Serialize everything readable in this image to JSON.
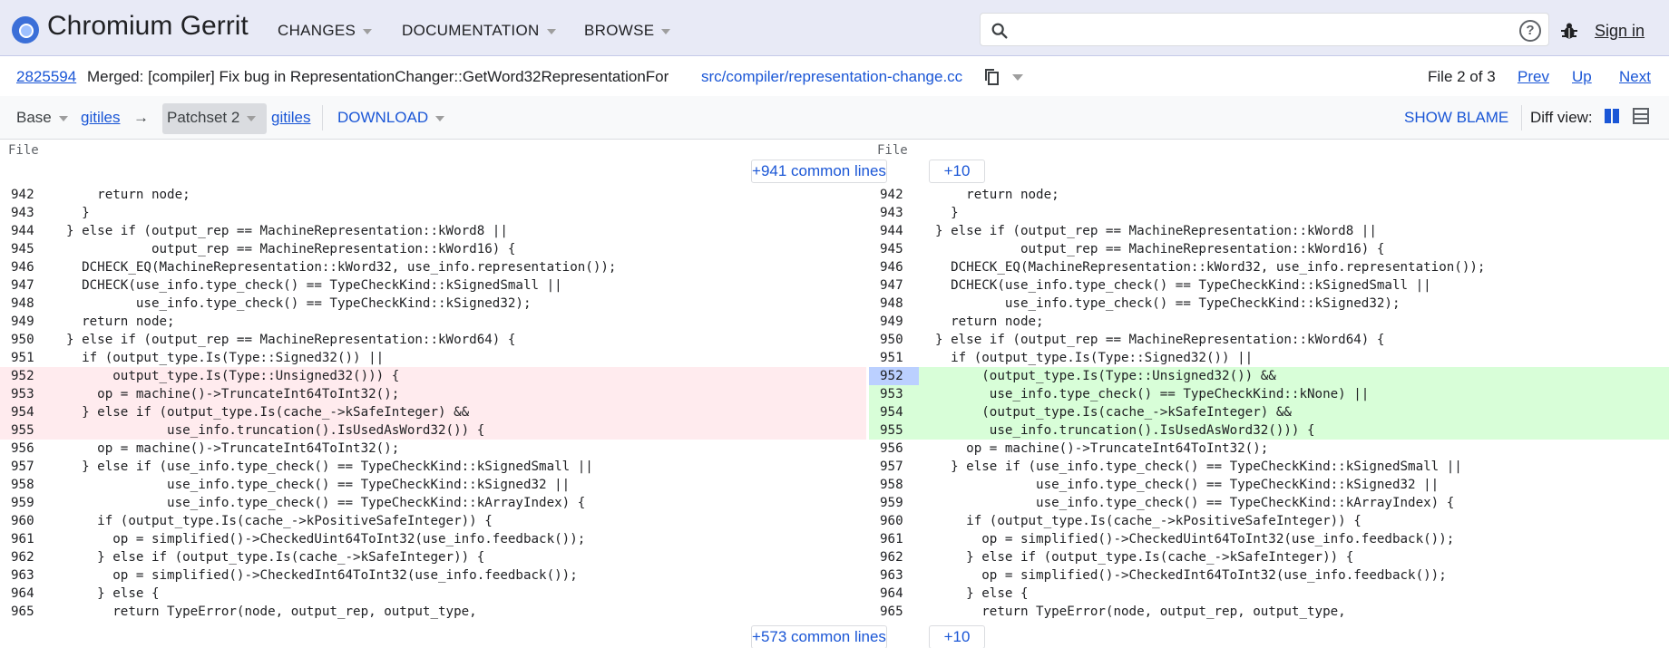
{
  "header": {
    "brand": "Chromium Gerrit",
    "nav": [
      "CHANGES",
      "DOCUMENTATION",
      "BROWSE"
    ],
    "search_placeholder": "",
    "sign_in": "Sign in"
  },
  "change": {
    "number": "2825594",
    "subject": "Merged: [compiler] Fix bug in RepresentationChanger::GetWord32RepresentationFor",
    "file_path": "src/compiler/representation-change.cc",
    "file_of": "File 2 of 3",
    "prev": "Prev",
    "up": "Up",
    "next": "Next"
  },
  "toolbar": {
    "base": "Base",
    "gitiles_left": "gitiles",
    "arrow": "→",
    "patchset": "Patchset 2",
    "gitiles_right": "gitiles",
    "download": "DOWNLOAD",
    "show_blame": "SHOW BLAME",
    "diff_view": "Diff view:"
  },
  "diff": {
    "file_label": "File",
    "top_common": "+941 common lines",
    "bottom_common": "+573 common lines",
    "plus_ten": "+10",
    "left_lines": [
      {
        "n": "942",
        "t": "    return node;"
      },
      {
        "n": "943",
        "t": "  }"
      },
      {
        "n": "944",
        "t": "} else if (output_rep == MachineRepresentation::kWord8 ||"
      },
      {
        "n": "945",
        "t": "           output_rep == MachineRepresentation::kWord16) {"
      },
      {
        "n": "946",
        "t": "  DCHECK_EQ(MachineRepresentation::kWord32, use_info.representation());"
      },
      {
        "n": "947",
        "t": "  DCHECK(use_info.type_check() == TypeCheckKind::kSignedSmall ||"
      },
      {
        "n": "948",
        "t": "         use_info.type_check() == TypeCheckKind::kSigned32);"
      },
      {
        "n": "949",
        "t": "  return node;"
      },
      {
        "n": "950",
        "t": "} else if (output_rep == MachineRepresentation::kWord64) {"
      },
      {
        "n": "951",
        "t": "  if (output_type.Is(Type::Signed32()) ||"
      },
      {
        "n": "952",
        "t": "      output_type.Is(Type::Unsigned32())) {"
      },
      {
        "n": "953",
        "t": "    op = machine()->TruncateInt64ToInt32();"
      },
      {
        "n": "954",
        "t": "  } else if (output_type.Is(cache_->kSafeInteger) &&"
      },
      {
        "n": "955",
        "t": "             use_info.truncation().IsUsedAsWord32()) {"
      },
      {
        "n": "956",
        "t": "    op = machine()->TruncateInt64ToInt32();"
      },
      {
        "n": "957",
        "t": "  } else if (use_info.type_check() == TypeCheckKind::kSignedSmall ||"
      },
      {
        "n": "958",
        "t": "             use_info.type_check() == TypeCheckKind::kSigned32 ||"
      },
      {
        "n": "959",
        "t": "             use_info.type_check() == TypeCheckKind::kArrayIndex) {"
      },
      {
        "n": "960",
        "t": "    if (output_type.Is(cache_->kPositiveSafeInteger)) {"
      },
      {
        "n": "961",
        "t": "      op = simplified()->CheckedUint64ToInt32(use_info.feedback());"
      },
      {
        "n": "962",
        "t": "    } else if (output_type.Is(cache_->kSafeInteger)) {"
      },
      {
        "n": "963",
        "t": "      op = simplified()->CheckedInt64ToInt32(use_info.feedback());"
      },
      {
        "n": "964",
        "t": "    } else {"
      },
      {
        "n": "965",
        "t": "      return TypeError(node, output_rep, output_type,"
      }
    ],
    "right_lines": [
      {
        "n": "942",
        "t": "    return node;"
      },
      {
        "n": "943",
        "t": "  }"
      },
      {
        "n": "944",
        "t": "} else if (output_rep == MachineRepresentation::kWord8 ||"
      },
      {
        "n": "945",
        "t": "           output_rep == MachineRepresentation::kWord16) {"
      },
      {
        "n": "946",
        "t": "  DCHECK_EQ(MachineRepresentation::kWord32, use_info.representation());"
      },
      {
        "n": "947",
        "t": "  DCHECK(use_info.type_check() == TypeCheckKind::kSignedSmall ||"
      },
      {
        "n": "948",
        "t": "         use_info.type_check() == TypeCheckKind::kSigned32);"
      },
      {
        "n": "949",
        "t": "  return node;"
      },
      {
        "n": "950",
        "t": "} else if (output_rep == MachineRepresentation::kWord64) {"
      },
      {
        "n": "951",
        "t": "  if (output_type.Is(Type::Signed32()) ||"
      },
      {
        "n": "952",
        "t": "      (output_type.Is(Type::Unsigned32()) &&"
      },
      {
        "n": "953",
        "t": "       use_info.type_check() == TypeCheckKind::kNone) ||"
      },
      {
        "n": "954",
        "t": "      (output_type.Is(cache_->kSafeInteger) &&"
      },
      {
        "n": "955",
        "t": "       use_info.truncation().IsUsedAsWord32())) {"
      },
      {
        "n": "956",
        "t": "    op = machine()->TruncateInt64ToInt32();"
      },
      {
        "n": "957",
        "t": "  } else if (use_info.type_check() == TypeCheckKind::kSignedSmall ||"
      },
      {
        "n": "958",
        "t": "             use_info.type_check() == TypeCheckKind::kSigned32 ||"
      },
      {
        "n": "959",
        "t": "             use_info.type_check() == TypeCheckKind::kArrayIndex) {"
      },
      {
        "n": "960",
        "t": "    if (output_type.Is(cache_->kPositiveSafeInteger)) {"
      },
      {
        "n": "961",
        "t": "      op = simplified()->CheckedUint64ToInt32(use_info.feedback());"
      },
      {
        "n": "962",
        "t": "    } else if (output_type.Is(cache_->kSafeInteger)) {"
      },
      {
        "n": "963",
        "t": "      op = simplified()->CheckedInt64ToInt32(use_info.feedback());"
      },
      {
        "n": "964",
        "t": "    } else {"
      },
      {
        "n": "965",
        "t": "      return TypeError(node, output_rep, output_type,"
      }
    ]
  },
  "colors": {
    "header_bg": "#e8eaf6",
    "link": "#1a56d6",
    "removed_bg": "#ffebee",
    "added_bg": "#d8fed8"
  }
}
